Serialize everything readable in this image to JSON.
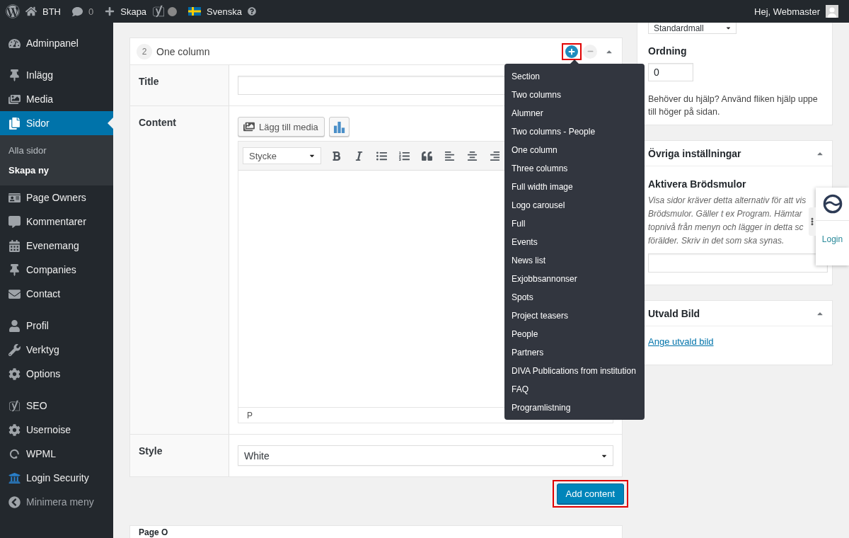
{
  "admin_bar": {
    "site_name": "BTH",
    "comment_count": "0",
    "new_label": "Skapa",
    "language": "Svenska",
    "greeting": "Hej, Webmaster"
  },
  "sidebar": {
    "groups": [
      {
        "items": [
          {
            "label": "Adminpanel",
            "selected": false
          }
        ]
      },
      {
        "items": [
          {
            "label": "Inlägg",
            "selected": false
          },
          {
            "label": "Media",
            "selected": false
          },
          {
            "label": "Sidor",
            "selected": true,
            "children": [
              {
                "label": "Alla sidor",
                "selected": false
              },
              {
                "label": "Skapa ny",
                "selected": true
              }
            ]
          },
          {
            "label": "Page Owners",
            "selected": false
          },
          {
            "label": "Kommentarer",
            "selected": false
          },
          {
            "label": "Evenemang",
            "selected": false
          },
          {
            "label": "Companies",
            "selected": false
          },
          {
            "label": "Contact",
            "selected": false
          }
        ]
      },
      {
        "items": [
          {
            "label": "Profil",
            "selected": false
          },
          {
            "label": "Verktyg",
            "selected": false
          },
          {
            "label": "Options",
            "selected": false
          }
        ]
      },
      {
        "items": [
          {
            "label": "SEO",
            "selected": false
          },
          {
            "label": "Usernoise",
            "selected": false
          },
          {
            "label": "WPML",
            "selected": false
          },
          {
            "label": "Login Security",
            "selected": false
          }
        ]
      }
    ],
    "collapse_label": "Minimera meny"
  },
  "module": {
    "number": "2",
    "title": "One column",
    "expanded": true,
    "add_highlighted": true,
    "menu": {
      "open": true,
      "items": [
        "Section",
        "Two columns",
        "Alumner",
        "Two columns - People",
        "One column",
        "Three columns",
        "Full width image",
        "Logo carousel",
        "Full",
        "Events",
        "News list",
        "Exjobbsannonser",
        "Spots",
        "Project teasers",
        "People",
        "Partners",
        "DIVA Publications from institution",
        "FAQ",
        "Programlistning"
      ]
    },
    "fields": [
      {
        "kind": "text",
        "label": "Title"
      },
      {
        "kind": "editor",
        "label": "Content",
        "media_button": "Lägg till media",
        "format": "Stycke",
        "path": "P"
      },
      {
        "kind": "select",
        "label": "Style",
        "value": "White"
      }
    ]
  },
  "add_content": {
    "label": "Add content",
    "highlighted": true
  },
  "next_module": {
    "title": "Page O"
  },
  "page_attributes": {
    "template": "Standardmall",
    "order_label": "Ordning",
    "order_value": "0",
    "help": "Behöver du hjälp? Använd fliken hjälp uppe till höger på sidan."
  },
  "other_settings": {
    "title": "Övriga inställningar",
    "expanded": true,
    "field_label": "Aktivera Brödsmulor",
    "description_lines": [
      "Visa sidor kräver detta alternativ för att vis",
      "Brödsmulor. Gäller t ex Program. Hämtar",
      "topnivå från menyn och lägger in detta sc",
      "förälder. Skriv in det som ska synas."
    ]
  },
  "featured_image": {
    "title": "Utvald Bild",
    "expanded": true,
    "link": "Ange utvald bild"
  },
  "login_widget": {
    "label": "Login"
  }
}
